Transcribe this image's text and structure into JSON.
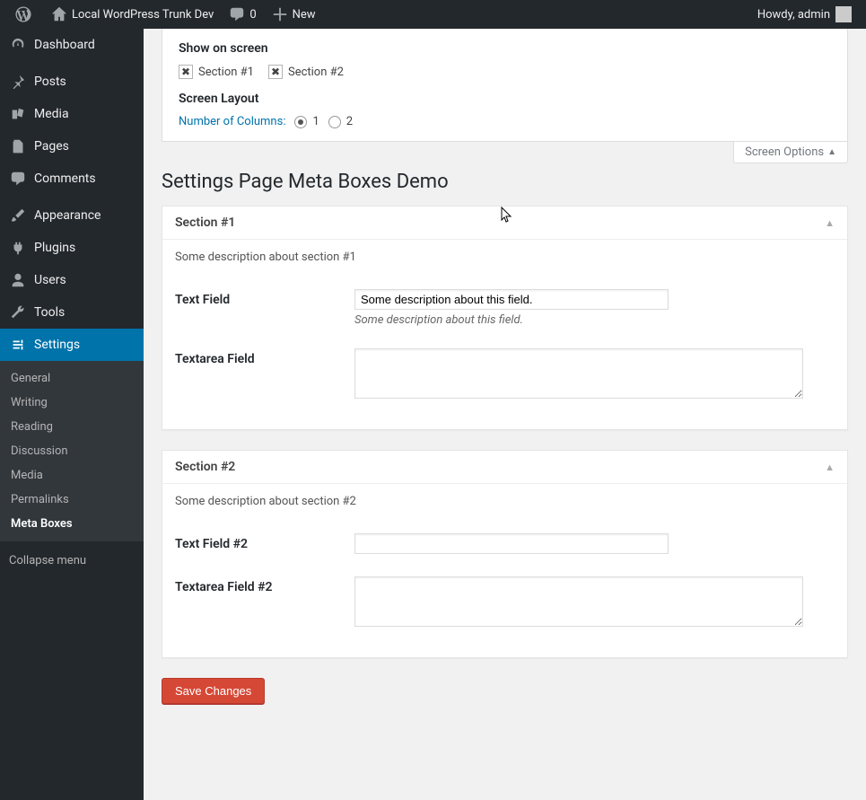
{
  "adminbar": {
    "site_name": "Local WordPress Trunk Dev",
    "comments_count": "0",
    "new_label": "New",
    "howdy": "Howdy, admin"
  },
  "sidebar": {
    "items": [
      {
        "label": "Dashboard",
        "icon": "dashboard"
      },
      {
        "label": "Posts",
        "icon": "pin"
      },
      {
        "label": "Media",
        "icon": "media"
      },
      {
        "label": "Pages",
        "icon": "pages"
      },
      {
        "label": "Comments",
        "icon": "comment"
      },
      {
        "label": "Appearance",
        "icon": "brush"
      },
      {
        "label": "Plugins",
        "icon": "plug"
      },
      {
        "label": "Users",
        "icon": "user"
      },
      {
        "label": "Tools",
        "icon": "wrench"
      },
      {
        "label": "Settings",
        "icon": "settings",
        "current": true
      }
    ],
    "settings_submenu": [
      {
        "label": "General"
      },
      {
        "label": "Writing"
      },
      {
        "label": "Reading"
      },
      {
        "label": "Discussion"
      },
      {
        "label": "Media"
      },
      {
        "label": "Permalinks"
      },
      {
        "label": "Meta Boxes",
        "current": true
      }
    ],
    "collapse_label": "Collapse menu"
  },
  "screen_options": {
    "show_on_screen_heading": "Show on screen",
    "checkboxes": [
      {
        "label": "Section #1",
        "checked": true
      },
      {
        "label": "Section #2",
        "checked": true
      }
    ],
    "screen_layout_heading": "Screen Layout",
    "columns_label": "Number of Columns:",
    "columns_options": [
      {
        "label": "1",
        "checked": true
      },
      {
        "label": "2",
        "checked": false
      }
    ],
    "tab_label": "Screen Options"
  },
  "page_title": "Settings Page Meta Boxes Demo",
  "sections": [
    {
      "title": "Section #1",
      "description": "Some description about section #1",
      "fields": [
        {
          "label": "Text Field",
          "type": "text",
          "value": "Some description about this field.",
          "description": "Some description about this field."
        },
        {
          "label": "Textarea Field",
          "type": "textarea",
          "value": ""
        }
      ]
    },
    {
      "title": "Section #2",
      "description": "Some description about section #2",
      "fields": [
        {
          "label": "Text Field #2",
          "type": "text",
          "value": ""
        },
        {
          "label": "Textarea Field #2",
          "type": "textarea",
          "value": ""
        }
      ]
    }
  ],
  "save_button": "Save Changes"
}
